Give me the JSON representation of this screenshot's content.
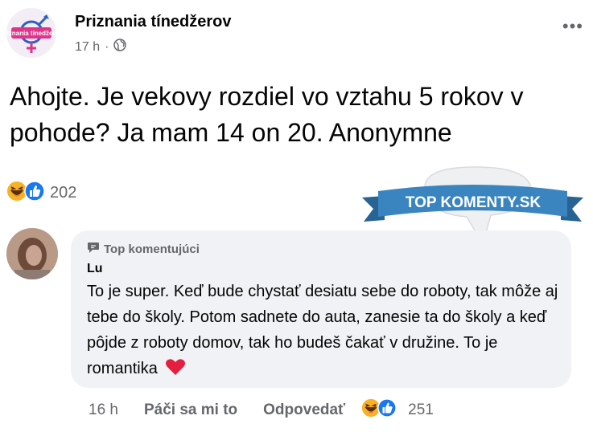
{
  "post": {
    "group_name": "Priznania tínedžerov",
    "avatar_logo_text": "Priznania tínedžerov",
    "time": "17 h",
    "separator": "·",
    "privacy_icon": "globe-icon",
    "more_icon": "more-options-icon",
    "more_glyph": "•••",
    "text": "Ahojte. Je vekovy rozdiel vo vztahu 5 rokov v pohode? Ja mam 14 on 20. Anonymne",
    "reactions": {
      "icons": [
        "haha-icon",
        "like-icon"
      ],
      "count": "202"
    }
  },
  "watermark": {
    "text": "TOP KOMENTY.SK",
    "colors": {
      "banner": "#3a85bf",
      "banner_dark": "#276393",
      "cloud": "#eef0f2"
    }
  },
  "comment": {
    "badge_icon": "top-commenter-icon",
    "badge_label": "Top komentujúci",
    "author": "Lu",
    "text": "To je super. Keď bude chystať desiatu sebe do roboty, tak môže aj tebe do školy. Potom sadnete do auta, zanesie ta do školy a keď pôjde z roboty domov, tak ho budeš čakať v družine. To je romantika",
    "emoji_icon": "red-heart-icon",
    "time": "16 h",
    "like_label": "Páči sa mi to",
    "reply_label": "Odpovedať",
    "reactions": {
      "icons": [
        "haha-icon",
        "like-icon"
      ],
      "count": "251"
    }
  },
  "colors": {
    "text": "#050505",
    "secondary": "#65676b",
    "bubble": "#f0f2f5",
    "like_blue": "#1877f2",
    "heart_red": "#e41e3f"
  }
}
